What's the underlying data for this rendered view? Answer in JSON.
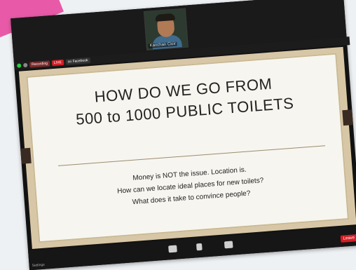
{
  "camera": {
    "name": "Kanchan Cicir"
  },
  "meeting_bar": {
    "recording": "Recording",
    "live": "LIVE",
    "live_on": "on Facebook"
  },
  "slide": {
    "title_line1": "HOW DO WE GO FROM",
    "title_line2": "500 to 1000 PUBLIC TOILETS",
    "body_line1": "Money is NOT the issue. Location is.",
    "body_line2": "How can we locate ideal places for new toilets?",
    "body_line3": "What does it take to convince people?"
  },
  "toolbar": {
    "settings_label": "Settings",
    "leave_label": "Leave"
  },
  "colors": {
    "accent_pink": "#e85aa8",
    "leave_red": "#d21f26",
    "slide_border": "#d8c7a6"
  }
}
